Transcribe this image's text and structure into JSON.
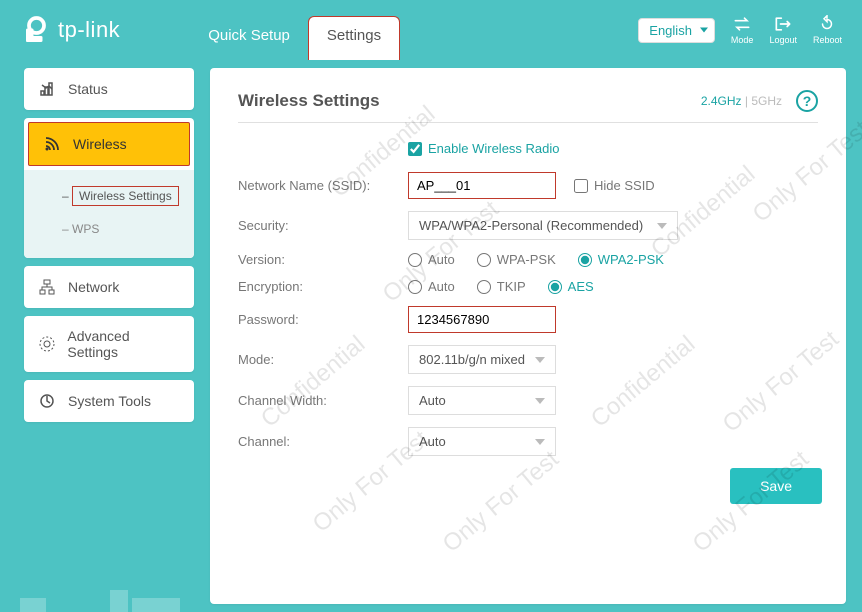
{
  "brand": "tp-link",
  "header": {
    "tabs": {
      "quick_setup": "Quick Setup",
      "settings": "Settings"
    },
    "language": "English",
    "icons": {
      "mode": "Mode",
      "logout": "Logout",
      "reboot": "Reboot"
    }
  },
  "sidebar": {
    "status": "Status",
    "wireless": "Wireless",
    "wireless_sub": {
      "settings": "Wireless Settings",
      "wps": "WPS"
    },
    "network": "Network",
    "advanced": "Advanced Settings",
    "system": "System Tools"
  },
  "page": {
    "title": "Wireless Settings",
    "bands": {
      "g24": "2.4GHz",
      "sep": "|",
      "g5": "5GHz"
    },
    "enable_label": "Enable Wireless Radio",
    "ssid_label": "Network Name (SSID):",
    "ssid_value": "AP___01",
    "hide_ssid": "Hide SSID",
    "security_label": "Security:",
    "security_value": "WPA/WPA2-Personal (Recommended)",
    "version_label": "Version:",
    "version_opts": {
      "auto": "Auto",
      "wpa": "WPA-PSK",
      "wpa2": "WPA2-PSK"
    },
    "encryption_label": "Encryption:",
    "encryption_opts": {
      "auto": "Auto",
      "tkip": "TKIP",
      "aes": "AES"
    },
    "password_label": "Password:",
    "password_value": "1234567890",
    "mode_label": "Mode:",
    "mode_value": "802.11b/g/n mixed",
    "cwidth_label": "Channel Width:",
    "cwidth_value": "Auto",
    "channel_label": "Channel:",
    "channel_value": "Auto",
    "save": "Save"
  },
  "watermark": {
    "conf": "Confidential",
    "test": "Only For Test"
  }
}
